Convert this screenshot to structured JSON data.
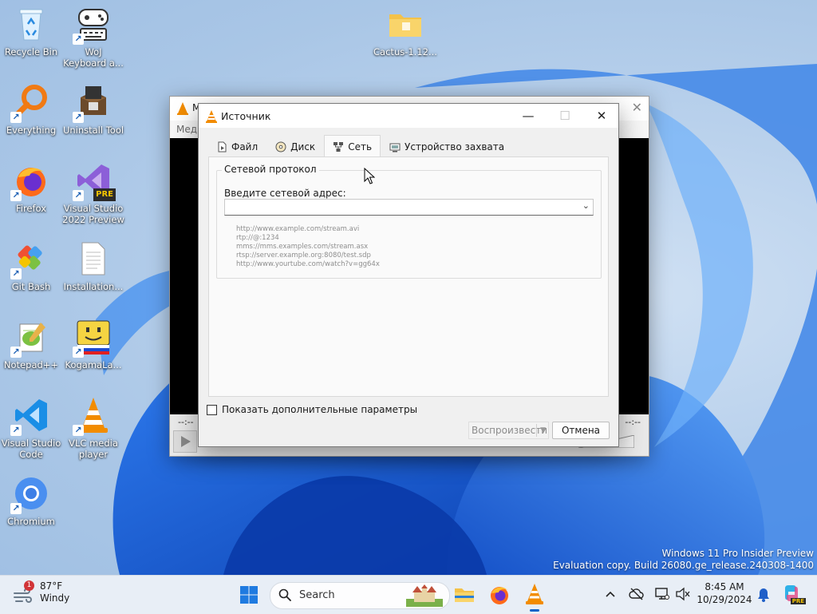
{
  "desktop": {
    "icons": [
      {
        "label": "Recycle Bin"
      },
      {
        "label": "WoJ Keyboard a..."
      },
      {
        "label": "Cactus-1.12..."
      },
      {
        "label": "Everything"
      },
      {
        "label": "Uninstall Tool"
      },
      {
        "label": "Firefox"
      },
      {
        "label": "Visual Studio 2022 Preview"
      },
      {
        "label": "Git Bash"
      },
      {
        "label": "Installation..."
      },
      {
        "label": "Notepad++"
      },
      {
        "label": "KogamaLa..."
      },
      {
        "label": "Visual Studio Code"
      },
      {
        "label": "VLC media player"
      },
      {
        "label": "Chromium"
      }
    ],
    "vs_badge": "PRE"
  },
  "vlc_main": {
    "title_fragment": "M",
    "menu_fragment": "Меди",
    "time_left": "--:--",
    "time_right": "--:--"
  },
  "dialog": {
    "title": "Источник",
    "tabs": [
      {
        "label": "Файл"
      },
      {
        "label": "Диск"
      },
      {
        "label": "Сеть"
      },
      {
        "label": "Устройство захвата"
      }
    ],
    "active_tab": "Сеть",
    "group_title": "Сетевой протокол",
    "address_label": "Введите сетевой адрес:",
    "address_value": "",
    "examples": [
      "http://www.example.com/stream.avi",
      "rtp://@:1234",
      "mms://mms.examples.com/stream.asx",
      "rtsp://server.example.org:8080/test.sdp",
      "http://www.yourtube.com/watch?v=gg64x"
    ],
    "show_more_label": "Показать дополнительные параметры",
    "show_more_checked": false,
    "play_label": "Воспроизвести",
    "cancel_label": "Отмена"
  },
  "watermark": {
    "line1": "Windows 11 Pro Insider Preview",
    "line2": "Evaluation copy. Build 26080.ge_release.240308-1400"
  },
  "taskbar": {
    "weather_temp": "87°F",
    "weather_desc": "Windy",
    "weather_badge": "1",
    "search_label": "Search",
    "time": "8:45 AM",
    "date": "10/29/2024",
    "copilot_badge": "PRE"
  },
  "colors": {
    "accent": "#0a64c8",
    "vlc_orange": "#f28c00",
    "taskbar": "#e8eef6"
  }
}
